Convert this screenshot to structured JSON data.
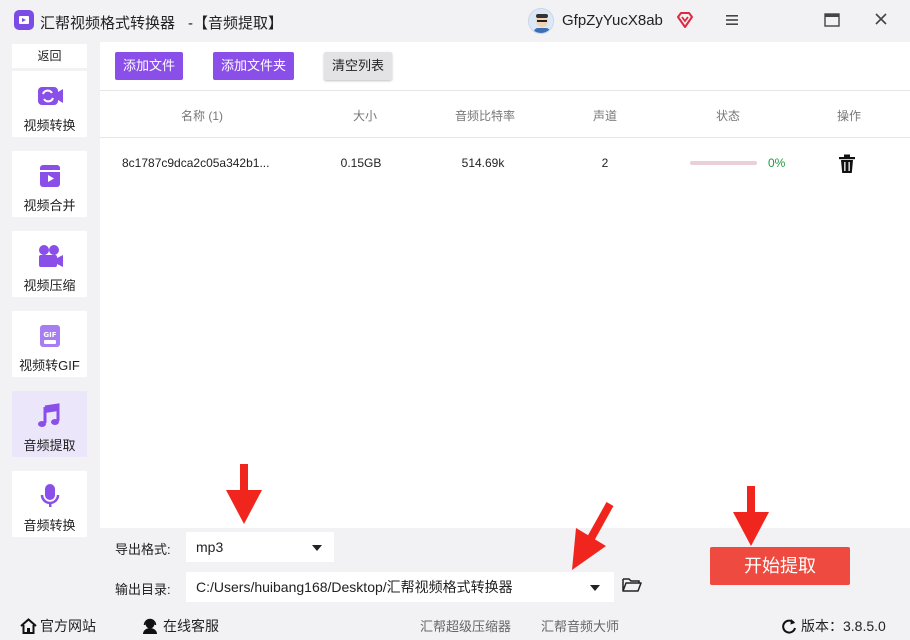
{
  "titlebar": {
    "app_name": "汇帮视频格式转换器",
    "subtitle": "-【音频提取】",
    "username": "GfpZyYucX8ab",
    "icons": [
      "app-logo-icon",
      "avatar",
      "vip-diamond-icon",
      "menu-icon",
      "maximize-icon",
      "close-icon"
    ]
  },
  "sidebar": {
    "back_label": "返回",
    "items": [
      {
        "label": "视频转换",
        "icon": "video-convert-icon"
      },
      {
        "label": "视频合并",
        "icon": "video-merge-icon"
      },
      {
        "label": "视频压缩",
        "icon": "video-compress-icon"
      },
      {
        "label": "视频转GIF",
        "icon": "gif-icon"
      },
      {
        "label": "音频提取",
        "icon": "music-note-icon",
        "active": true
      },
      {
        "label": "音频转换",
        "icon": "microphone-icon"
      }
    ]
  },
  "toolbar": {
    "add_file": "添加文件",
    "add_folder": "添加文件夹",
    "clear_list": "清空列表"
  },
  "table": {
    "headers": [
      "名称 (1)",
      "大小",
      "音频比特率",
      "声道",
      "状态",
      "操作"
    ],
    "rows": [
      {
        "name": "8c1787c9dca2c05a342b1...",
        "size": "0.15GB",
        "bitrate": "514.69k",
        "channels": "2",
        "progress": 0,
        "status": "0%"
      }
    ]
  },
  "settings": {
    "format_label": "导出格式:",
    "format_value": "mp3",
    "dir_label": "输出目录:",
    "dir_value": "C:/Users/huibang168/Desktop/汇帮视频格式转换器",
    "start_button": "开始提取"
  },
  "footer": {
    "website": "官方网站",
    "support": "在线客服",
    "link1": "汇帮超级压缩器",
    "link2": "汇帮音频大师",
    "version": "版本：3.8.5.0"
  },
  "colors": {
    "accent": "#8a4fe9",
    "start": "#ee4a3f",
    "annotation": "#f0251d",
    "status_ok": "#1a9b3a"
  }
}
